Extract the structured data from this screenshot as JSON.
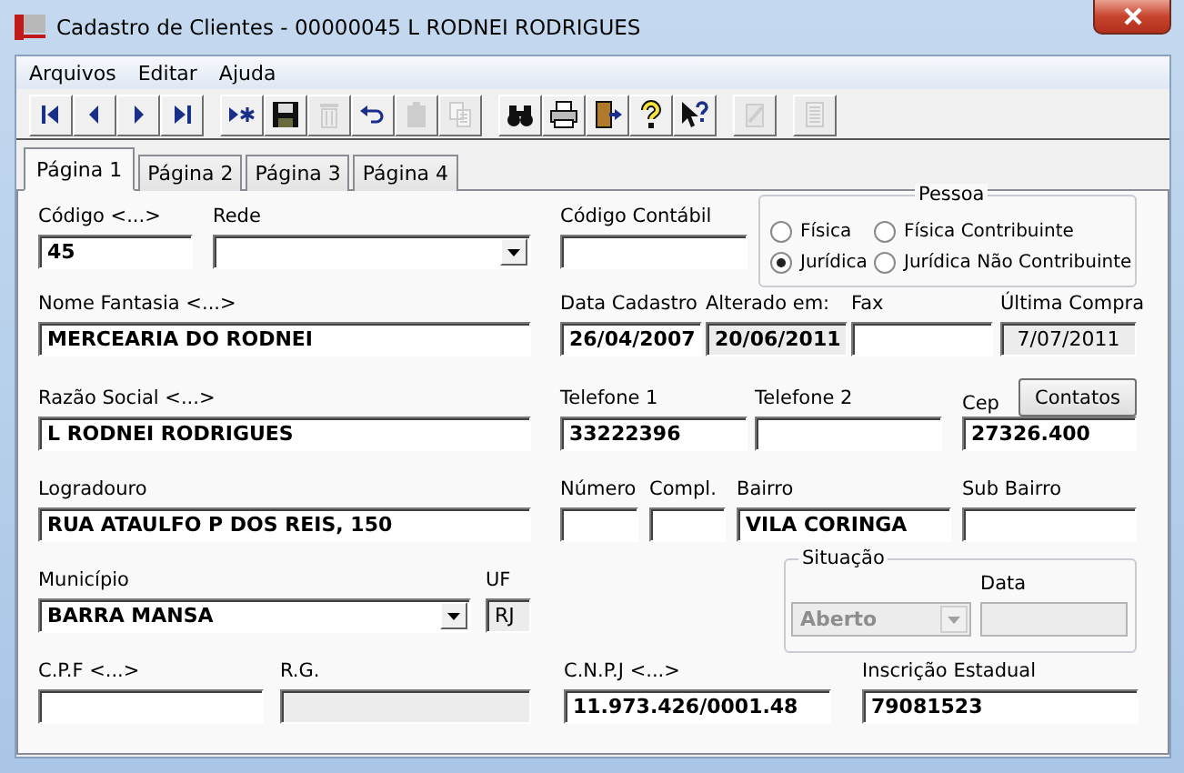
{
  "window": {
    "title": "Cadastro de Clientes - 00000045 L RODNEI RODRIGUES"
  },
  "menu": [
    {
      "label": "Arquivos"
    },
    {
      "label": "Editar"
    },
    {
      "label": "Ajuda"
    }
  ],
  "toolbar": [
    {
      "buttons": [
        {
          "kind": "first",
          "disabled": false
        },
        {
          "kind": "prev",
          "disabled": false
        },
        {
          "kind": "next",
          "disabled": false
        },
        {
          "kind": "last",
          "disabled": false
        }
      ]
    },
    {
      "buttons": [
        {
          "kind": "new",
          "disabled": false
        },
        {
          "kind": "save",
          "disabled": false
        },
        {
          "kind": "delete",
          "disabled": true
        },
        {
          "kind": "undo",
          "disabled": false
        },
        {
          "kind": "paste",
          "disabled": true
        },
        {
          "kind": "copy",
          "disabled": true
        }
      ]
    },
    {
      "buttons": [
        {
          "kind": "find",
          "disabled": false
        },
        {
          "kind": "print",
          "disabled": false
        },
        {
          "kind": "exit",
          "disabled": false
        },
        {
          "kind": "help",
          "disabled": false
        },
        {
          "kind": "context-help",
          "disabled": false
        }
      ]
    },
    {
      "buttons": [
        {
          "kind": "edit",
          "disabled": true
        }
      ]
    },
    {
      "buttons": [
        {
          "kind": "report",
          "disabled": true
        }
      ]
    }
  ],
  "tabs": [
    {
      "label": "Página 1",
      "selected": true
    },
    {
      "label": "Página 2",
      "selected": false
    },
    {
      "label": "Página 3",
      "selected": false
    },
    {
      "label": "Página 4",
      "selected": false
    }
  ],
  "rows": [
    {
      "items": [
        {
          "kind": "text",
          "label": "Código <...>",
          "value": "45",
          "readonly": false,
          "bold": true
        },
        {
          "kind": "combo",
          "label": "Rede",
          "readonly": false
        },
        {
          "kind": "text",
          "label": "Código Contábil",
          "readonly": false
        },
        {
          "kind": "radio-group",
          "title": "Pessoa",
          "options": [
            {
              "label": "Física",
              "selected": false
            },
            {
              "label": "Física Contribuinte",
              "selected": false
            },
            {
              "label": "Jurídica",
              "selected": true
            },
            {
              "label": "Jurídica Não Contribuinte",
              "selected": false
            }
          ]
        }
      ]
    },
    {
      "items": [
        {
          "kind": "text",
          "label": "Nome Fantasia <...>",
          "value": "MERCEARIA DO RODNEI",
          "readonly": false,
          "bold": true
        },
        {
          "kind": "text",
          "label": "Data Cadastro",
          "value": "26/04/2007",
          "readonly": false,
          "bold": true
        },
        {
          "kind": "text",
          "label": "Alterado em:",
          "value": "20/06/2011",
          "readonly": true,
          "bold": true
        },
        {
          "kind": "text",
          "label": "Fax",
          "readonly": false
        },
        {
          "kind": "text",
          "label": "Última Compra",
          "value": "7/07/2011",
          "readonly": true,
          "bold": false
        }
      ]
    },
    {
      "items": [
        {
          "kind": "text",
          "label": "Razão Social <...>",
          "value": "L RODNEI RODRIGUES",
          "readonly": false,
          "bold": true
        },
        {
          "kind": "text",
          "label": "Telefone 1",
          "value": "33222396",
          "readonly": false,
          "bold": true
        },
        {
          "kind": "text",
          "label": "Telefone 2",
          "readonly": false
        },
        {
          "kind": "text",
          "label": "Cep",
          "value": "27326.400",
          "readonly": false,
          "bold": true,
          "action": "Contatos"
        }
      ]
    },
    {
      "items": [
        {
          "kind": "text",
          "label": "Logradouro",
          "value": "RUA ATAULFO P DOS REIS, 150",
          "readonly": false,
          "bold": true
        },
        {
          "kind": "text",
          "label": "Número",
          "readonly": false
        },
        {
          "kind": "text",
          "label": "Compl.",
          "readonly": false
        },
        {
          "kind": "text",
          "label": "Bairro",
          "value": "VILA CORINGA",
          "readonly": false,
          "bold": true
        },
        {
          "kind": "text",
          "label": "Sub Bairro",
          "readonly": false
        }
      ]
    },
    {
      "items": [
        {
          "kind": "combo",
          "label": "Município",
          "value": "BARRA MANSA",
          "readonly": false,
          "bold": true
        },
        {
          "kind": "text",
          "label": "UF",
          "value": "RJ",
          "readonly": true,
          "bold": false
        },
        {
          "kind": "status-group",
          "title": "Situação",
          "value": "Aberto",
          "disabled": true,
          "date_label": "Data"
        }
      ]
    },
    {
      "items": [
        {
          "kind": "text",
          "label": "C.P.F <...>",
          "readonly": false
        },
        {
          "kind": "text",
          "label": "R.G.",
          "readonly": true
        },
        {
          "kind": "text",
          "label": "C.N.P.J <...>",
          "value": "11.973.426/0001.48",
          "readonly": false,
          "bold": true
        },
        {
          "kind": "text",
          "label": "Inscrição Estadual",
          "value": "79081523",
          "readonly": false,
          "bold": true
        }
      ]
    }
  ]
}
